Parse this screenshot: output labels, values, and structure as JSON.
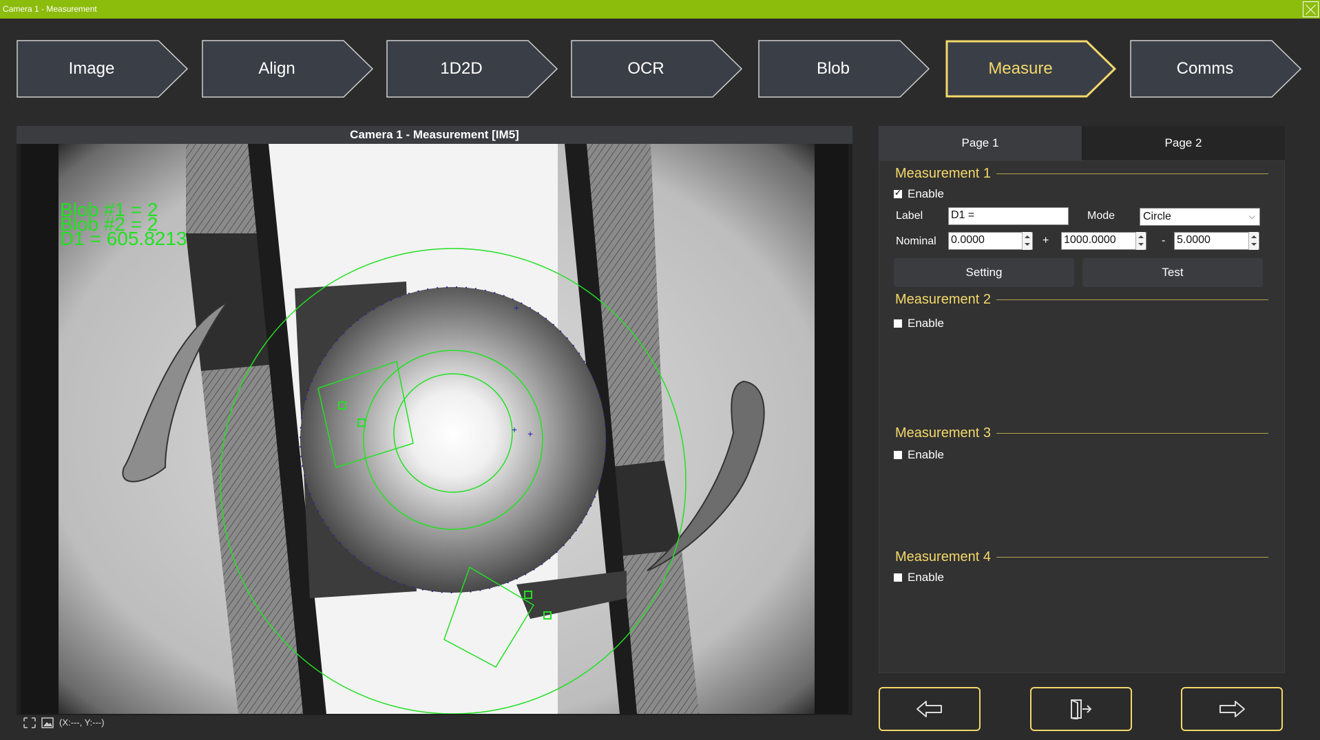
{
  "window": {
    "title": "Camera 1 - Measurement"
  },
  "steps": [
    {
      "label": "Image",
      "active": false
    },
    {
      "label": "Align",
      "active": false
    },
    {
      "label": "1D2D",
      "active": false
    },
    {
      "label": "OCR",
      "active": false
    },
    {
      "label": "Blob",
      "active": false
    },
    {
      "label": "Measure",
      "active": true
    },
    {
      "label": "Comms",
      "active": false
    }
  ],
  "viewer": {
    "title": "Camera 1 -  Measurement  [IM5]",
    "overlay_lines": [
      "Blob #1 = 2",
      "Blob #2 = 2",
      "D1 = 605.8213"
    ],
    "coord_readout": "(X:---, Y:---)"
  },
  "tabs": {
    "page1": "Page 1",
    "page2": "Page 2"
  },
  "measurements": {
    "m1": {
      "title": "Measurement 1",
      "enable_label": "Enable",
      "enabled": true,
      "label_caption": "Label",
      "label_value": "D1 =",
      "mode_caption": "Mode",
      "mode_value": "Circle",
      "nominal_caption": "Nominal",
      "nominal_value": "0.0000",
      "plus_sign": "+",
      "plus_value": "1000.0000",
      "minus_sign": "-",
      "minus_value": "5.0000",
      "setting_label": "Setting",
      "test_label": "Test"
    },
    "m2": {
      "title": "Measurement 2",
      "enable_label": "Enable",
      "enabled": false
    },
    "m3": {
      "title": "Measurement 3",
      "enable_label": "Enable",
      "enabled": false
    },
    "m4": {
      "title": "Measurement 4",
      "enable_label": "Enable",
      "enabled": false
    }
  },
  "nav": {
    "back_icon": "arrow-left-icon",
    "exit_icon": "exit-door-icon",
    "next_icon": "arrow-right-icon"
  },
  "colors": {
    "titlebar": "#8cbc0c",
    "accent": "#f4d86a",
    "overlay_green": "#22e022"
  }
}
